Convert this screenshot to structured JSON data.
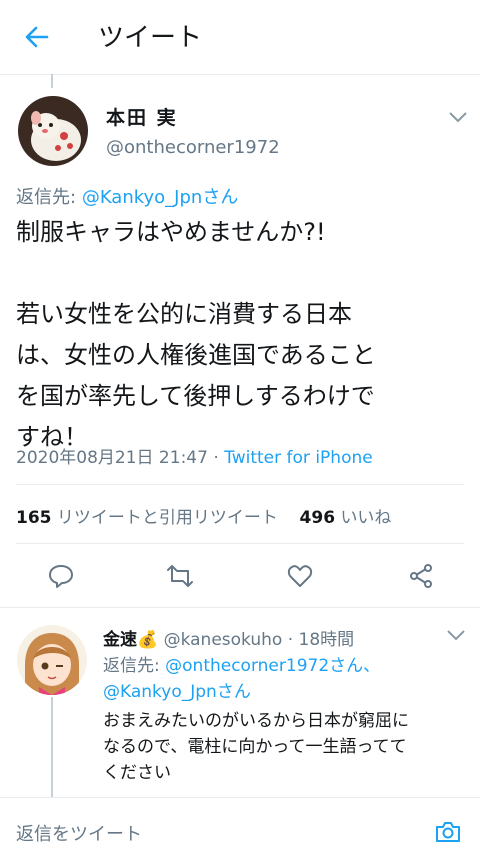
{
  "header": {
    "title": "ツイート",
    "back_icon": "arrow-left-icon",
    "accent_color": "#1da1f2"
  },
  "tweet": {
    "author_name": "本田 実",
    "author_handle": "@onthecorner1972",
    "replying_prefix": "返信先:",
    "replying_to": "@Kankyo_Jpnさん",
    "text_lines": [
      "制服キャラはやめませんか?!",
      "",
      "若い女性を公的に消費する日本",
      "は、女性の人権後進国であること",
      "を国が率先して後押しするわけで",
      "すね！"
    ],
    "timestamp": "2020年08月21日 21:47",
    "separator": " · ",
    "source": "Twitter for iPhone",
    "retweet_count": "165",
    "retweet_label": "リツイートと引用リツイート",
    "like_count": "496",
    "like_label": "いいね"
  },
  "actions": {
    "reply_icon": "reply-icon",
    "retweet_icon": "retweet-icon",
    "like_icon": "heart-icon",
    "share_icon": "share-icon"
  },
  "reply": {
    "name": "金速",
    "name_emoji": "💰",
    "handle": "@kanesokuho",
    "time": "· 18時間",
    "replying_prefix": "返信先:",
    "replying_to_1": "@onthecorner1972さん、",
    "replying_to_2": "@Kankyo_Jpnさん",
    "text_lines": [
      "おまえみたいのがいるから日本が窮屈に",
      "なるので、電柱に向かって一生語ってて",
      "ください"
    ]
  },
  "compose": {
    "placeholder": "返信をツイート",
    "camera_icon": "camera-icon"
  }
}
